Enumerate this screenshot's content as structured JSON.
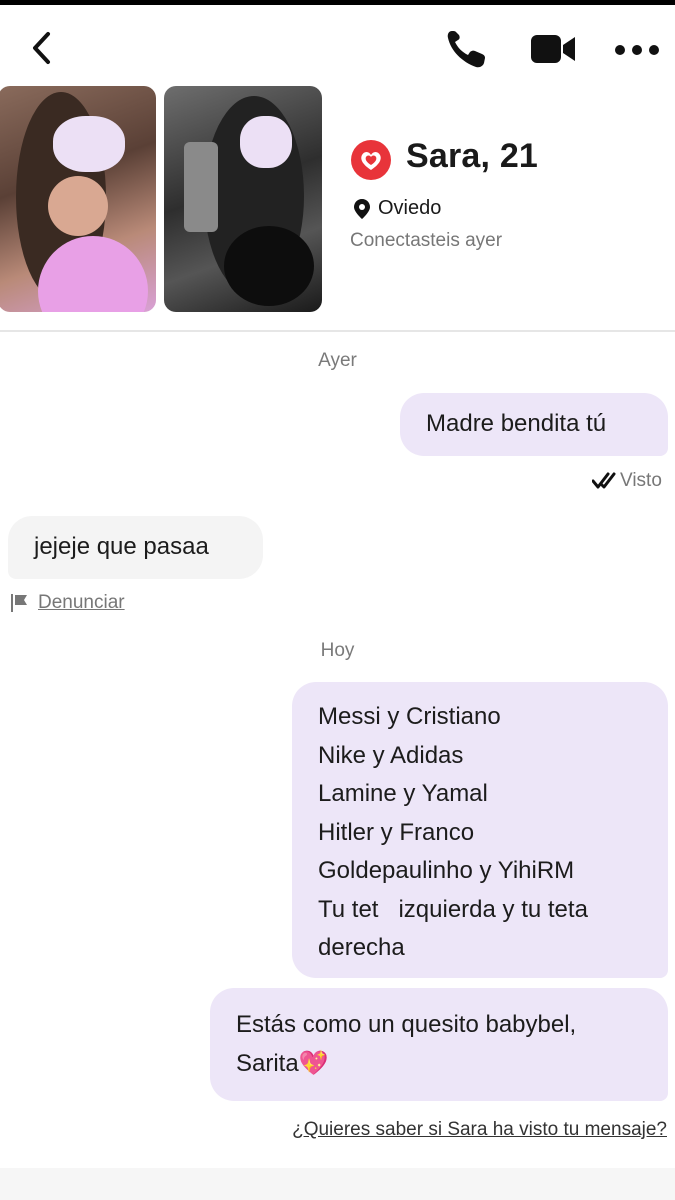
{
  "profile": {
    "name_age": "Sara, 21",
    "city": "Oviedo",
    "connected": "Conectasteis ayer"
  },
  "icons": {
    "back": "chevron-left-icon",
    "call": "phone-icon",
    "video": "video-camera-icon",
    "more": "more-dots-icon",
    "badge": "heart-badge-icon",
    "location": "location-pin-icon",
    "seen": "double-check-icon",
    "report": "flag-icon"
  },
  "colors": {
    "accent": "#e8343a",
    "outgoing_bubble": "#ede6f8",
    "incoming_bubble": "#f4f4f4"
  },
  "chat": {
    "day1": "Ayer",
    "day2": "Hoy",
    "msg_out_1": "Madre bendita tú",
    "seen_label": "Visto",
    "msg_in_1": "jejeje que pasaa",
    "report_label": "Denunciar",
    "msg_out_2_lines": [
      "Messi y Cristiano",
      "Nike y Adidas",
      "Lamine y Yamal",
      "Hitler y Franco",
      "Goldepaulinho y YihiRM",
      "Tu tet   izquierda y tu teta",
      "derecha"
    ],
    "msg_out_3_lines": [
      "Estás como un quesito babybel,",
      "Sarita💖"
    ],
    "upsell_link": "¿Quieres saber si Sara ha visto tu mensaje?"
  }
}
